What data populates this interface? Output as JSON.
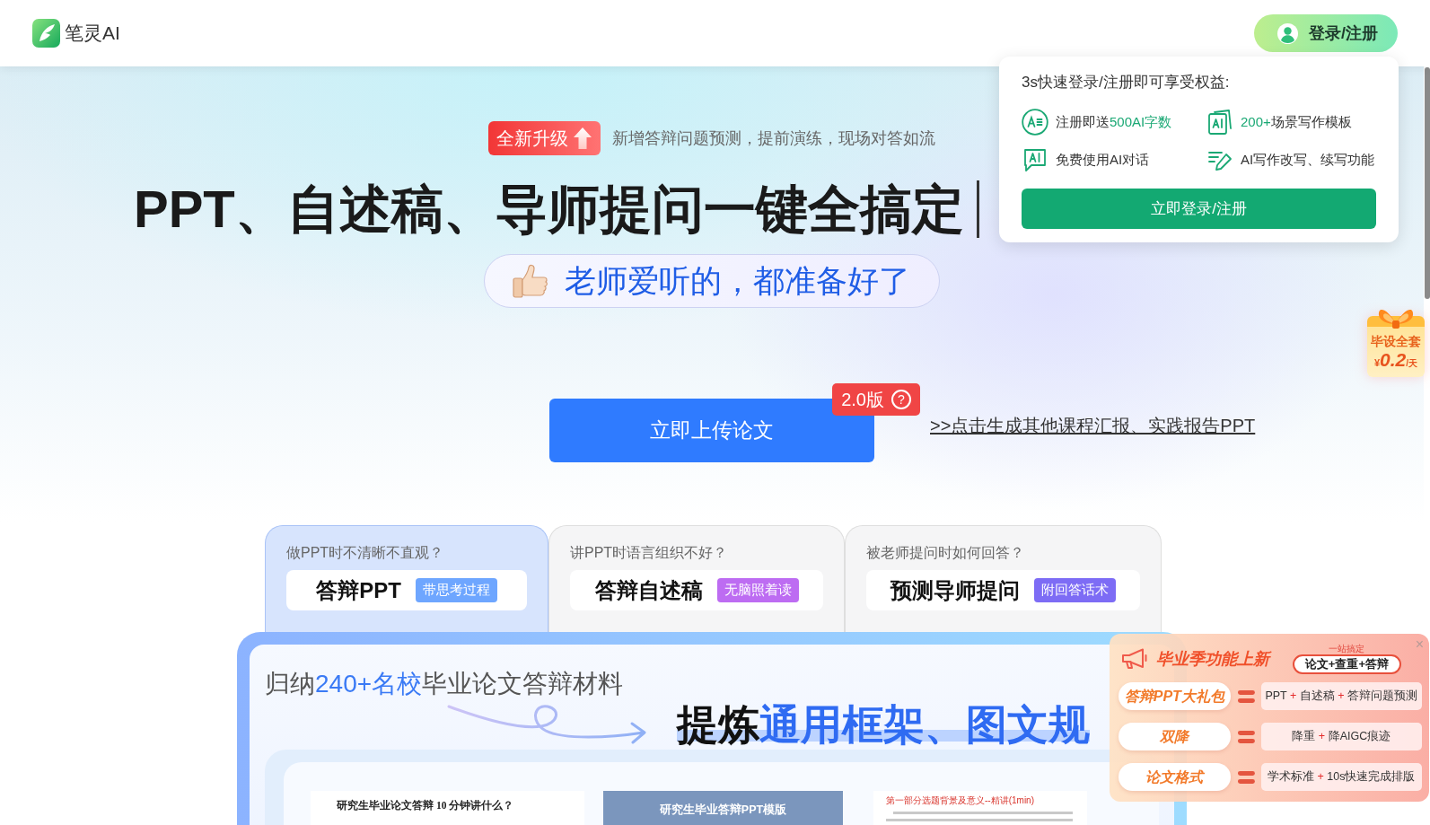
{
  "header": {
    "logo_text": "笔灵AI",
    "login_button": "登录/注册"
  },
  "login_popup": {
    "title": "3s快速登录/注册即可享受权益:",
    "benefits": [
      {
        "kind": "words",
        "parts": [
          {
            "text": "注册即送",
            "highlight": false
          },
          {
            "text": "500AI字数",
            "highlight": true
          }
        ]
      },
      {
        "kind": "templates",
        "parts": [
          {
            "text": "200+",
            "highlight": true
          },
          {
            "text": "场景写作模板",
            "highlight": false
          }
        ]
      },
      {
        "kind": "chat",
        "parts": [
          {
            "text": "免费使用AI对话",
            "highlight": false
          }
        ]
      },
      {
        "kind": "rewrite",
        "parts": [
          {
            "text": "AI写作改写、续写功能",
            "highlight": false
          }
        ]
      }
    ],
    "button": "立即登录/注册"
  },
  "hero": {
    "badge": "全新升级",
    "badge_note": "新增答辩问题预测，提前演练，现场对答如流",
    "headline": "PPT、自述稿、导师提问一键全搞定",
    "subtitle": "老师爱听的，都准备好了",
    "upload_button": "立即上传论文",
    "version_badge": "2.0版",
    "help_glyph": "?",
    "other_link": ">>点击生成其他课程汇报、实践报告PPT"
  },
  "gift_widget": {
    "title": "毕设全套",
    "price_parts": [
      "¥",
      "0.2",
      "/天"
    ]
  },
  "tabs": [
    {
      "question": "做PPT时不清晰不直观？",
      "title": "答辩PPT",
      "tag": "带思考过程",
      "color": "#6ea6ff",
      "selected": true
    },
    {
      "question": "讲PPT时语言组织不好？",
      "title": "答辩自述稿",
      "tag": "无脑照着读",
      "color": "#bd6cf2",
      "selected": false
    },
    {
      "question": "被老师提问时如何回答？",
      "title": "预测导师提问",
      "tag": "附回答话术",
      "color": "#7d6cf5",
      "selected": false
    }
  ],
  "showcase": {
    "intro_parts": [
      {
        "text": "归纳",
        "highlight": false
      },
      {
        "text": "240+名校",
        "highlight": true
      },
      {
        "text": "毕业论文答辩材料",
        "highlight": false
      }
    ],
    "headline_parts": [
      {
        "text": "提炼",
        "highlight": false
      },
      {
        "text": "通用框架、图文规",
        "highlight": true
      }
    ],
    "documents": [
      {
        "kind": "page",
        "title": "研究生毕业论文答辩 10 分钟讲什么？"
      },
      {
        "kind": "slide",
        "title": "研究生毕业答辩PPT模版"
      },
      {
        "kind": "notes",
        "title": "第一部分选题背景及意义--精讲(1min)"
      }
    ]
  },
  "promo": {
    "title": "毕业季功能上新",
    "tagline": "一站搞定",
    "pill": "论文+查重+答辩",
    "close_glyph": "×",
    "rows": [
      {
        "name": "答辩PPT大礼包",
        "parts": [
          "PPT",
          "+",
          "自述稿",
          "+",
          "答辩问题预测"
        ]
      },
      {
        "name": "双降",
        "parts": [
          "降重",
          "+",
          "降AIGC痕迹"
        ]
      },
      {
        "name": "论文格式",
        "parts": [
          "学术标准",
          "+",
          "10s快速完成排版"
        ]
      }
    ]
  }
}
